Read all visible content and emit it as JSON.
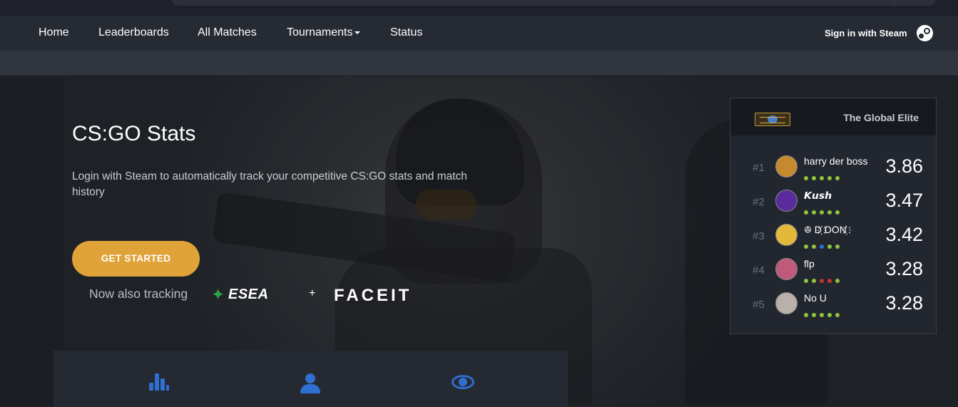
{
  "nav": {
    "items": [
      {
        "label": "Home"
      },
      {
        "label": "Leaderboards"
      },
      {
        "label": "All Matches"
      },
      {
        "label": "Tournaments"
      },
      {
        "label": "Status"
      }
    ],
    "signin": "Sign in with Steam"
  },
  "hero": {
    "title": "CS:GO Stats",
    "lead": "Login with Steam to automatically track your competitive CS:GO stats and match history",
    "cta": "GET STARTED",
    "also_tracking": "Now also tracking",
    "esea": "ESEA",
    "plus": "+",
    "faceit": "FACEIT"
  },
  "leaderboard": {
    "title": "The Global Elite",
    "rows": [
      {
        "rank": "#1",
        "name": "harry der boss",
        "score": "3.86",
        "avatar_color": "#c58a2e",
        "dots": [
          "#8cc63f",
          "#8cc63f",
          "#8cc63f",
          "#8cc63f",
          "#8cc63f"
        ]
      },
      {
        "rank": "#2",
        "name": "𝙆𝙪𝙨𝙝",
        "score": "3.47",
        "avatar_color": "#5a2b9a",
        "dots": [
          "#8cc63f",
          "#8cc63f",
          "#8cc63f",
          "#8cc63f",
          "#8cc63f"
        ]
      },
      {
        "rank": "#3",
        "name": "ꔮ D҉ DON҉",
        "score": "3.42",
        "avatar_color": "#e2b93b",
        "dots": [
          "#8cc63f",
          "#8cc63f",
          "#2f6fd1",
          "#8cc63f",
          "#8cc63f"
        ]
      },
      {
        "rank": "#4",
        "name": "flp",
        "score": "3.28",
        "avatar_color": "#c05a7a",
        "dots": [
          "#8cc63f",
          "#8cc63f",
          "#c0392b",
          "#c0392b",
          "#8cc63f"
        ]
      },
      {
        "rank": "#5",
        "name": "No U",
        "score": "3.28",
        "avatar_color": "#b9b0aa",
        "dots": [
          "#8cc63f",
          "#8cc63f",
          "#8cc63f",
          "#8cc63f",
          "#8cc63f"
        ]
      }
    ]
  }
}
